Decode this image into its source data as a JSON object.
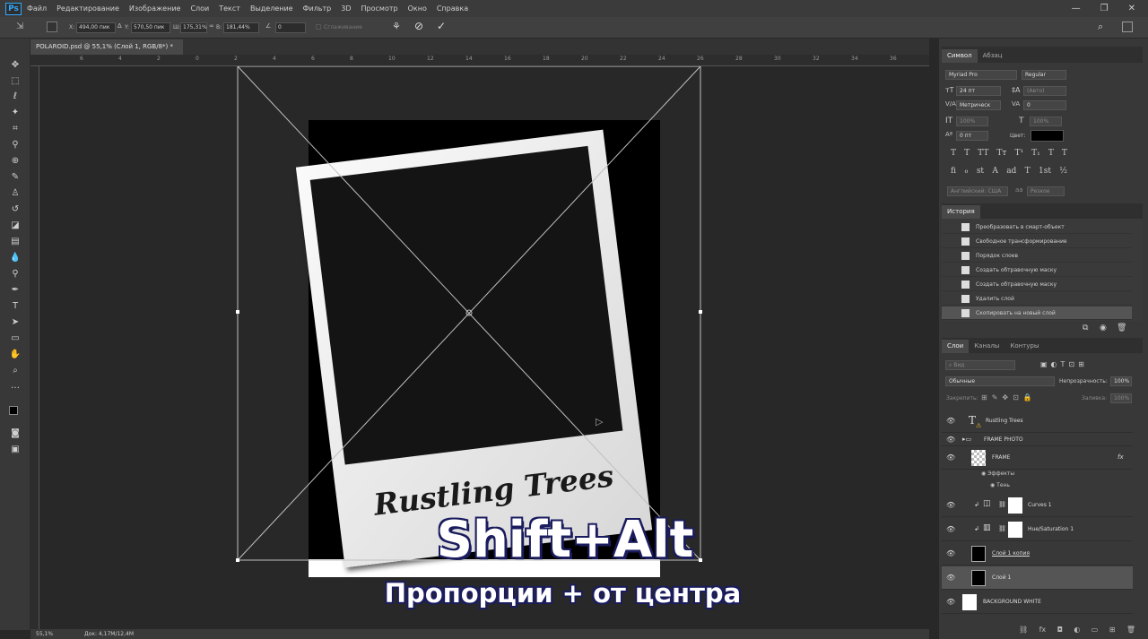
{
  "app": {
    "logo": "Ps"
  },
  "menu": [
    "Файл",
    "Редактирование",
    "Изображение",
    "Слои",
    "Текст",
    "Выделение",
    "Фильтр",
    "3D",
    "Просмотр",
    "Окно",
    "Справка"
  ],
  "window_controls": {
    "minimize": "—",
    "maximize": "❐",
    "close": "✕"
  },
  "options_bar": {
    "x_label": "X:",
    "x_value": "494,00 пик",
    "y_label": "Y:",
    "y_value": "570,50 пик",
    "w_label": "Ш:",
    "w_value": "175,31%",
    "h_label": "В:",
    "h_value": "181,44%",
    "angle_value": "0",
    "interp_label": "Сглаживание"
  },
  "document": {
    "tab_title": "POLAROID.psd @ 55,1% (Слой 1, RGB/8*) *",
    "close": "×"
  },
  "ruler": {
    "h_ticks": [
      "6",
      "4",
      "2",
      "0",
      "2",
      "4",
      "6",
      "8",
      "10",
      "12",
      "14",
      "16",
      "18",
      "20",
      "22",
      "24",
      "26",
      "28",
      "30",
      "32",
      "34",
      "36"
    ]
  },
  "canvas": {
    "polaroid_text": "Rustling Trees"
  },
  "status": {
    "zoom": "55,1%",
    "doc": "Док: 4,17М/12,4М"
  },
  "character_panel": {
    "tabs": [
      "Символ",
      "Абзац"
    ],
    "font_family": "Myriad Pro",
    "font_style": "Regular",
    "size": "24 пт",
    "leading": "(Авто)",
    "kerning": "Метрическ",
    "tracking": "0",
    "vscale": "100%",
    "hscale": "100%",
    "baseline": "0 пт",
    "color_label": "Цвет:",
    "language": "Английский: США",
    "antialias": "Резкое",
    "style_buttons_row1": [
      "T",
      "T",
      "TT",
      "Tт",
      "T¹",
      "T₁",
      "T",
      "T"
    ],
    "style_buttons_row2": [
      "fi",
      "ℴ",
      "st",
      "A",
      "ad",
      "T",
      "1st",
      "½"
    ]
  },
  "history_panel": {
    "title": "История",
    "items": [
      "Преобразовать в смарт-объект",
      "Свободное трансформирование",
      "Порядок слоев",
      "Создать обтравочную маску",
      "Создать обтравочную маску",
      "Удалить слой",
      "Скопировать на новый слой"
    ]
  },
  "layers_panel": {
    "tabs": [
      "Слои",
      "Каналы",
      "Контуры"
    ],
    "filter_placeholder": "Вид",
    "blend_mode": "Обычные",
    "opacity_label": "Непрозрачность:",
    "opacity_value": "100%",
    "lock_label": "Закрепить:",
    "fill_label": "Заливка:",
    "fill_value": "100%",
    "layers": [
      {
        "name": "Rustling Trees"
      },
      {
        "name": "FRAME PHOTO"
      },
      {
        "name": "FRAME"
      },
      {
        "name": "Эффекты"
      },
      {
        "name": "Тень"
      },
      {
        "name": "Curves 1"
      },
      {
        "name": "Hue/Saturation 1"
      },
      {
        "name": "Слой 1 копия"
      },
      {
        "name": "Слой 1"
      },
      {
        "name": "BACKGROUND WHITE"
      }
    ],
    "fx_badge": "fx"
  },
  "subtitles": {
    "line1": "Shift+Alt",
    "line2": "Пропорции + от центра"
  },
  "colors": {
    "accent": "#31a8ff",
    "subtitle_outline": "#1a1c5e",
    "panel_bg": "#383838",
    "canvas_bg": "#282828"
  }
}
